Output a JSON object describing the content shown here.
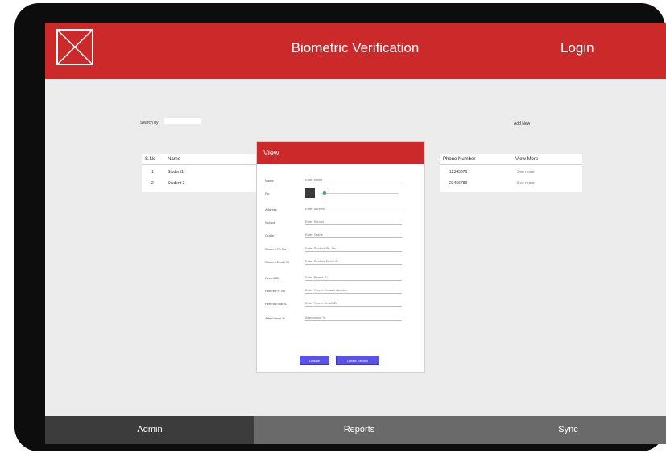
{
  "header": {
    "title": "Biometric Verification",
    "login_label": "Login"
  },
  "toolbar": {
    "search_label": "Search by",
    "add_new_label": "Add New"
  },
  "table": {
    "headers": [
      "S.No",
      "Name",
      "Phone Number",
      "View More"
    ],
    "rows": [
      {
        "sno": "1",
        "name": "Student1",
        "phone": "12345678",
        "view": "See more"
      },
      {
        "sno": "2",
        "name": "Student 2",
        "phone": "23456789",
        "view": "See more"
      }
    ]
  },
  "modal": {
    "title": "View",
    "fields": [
      {
        "label": "Name",
        "placeholder": "Enter Name"
      },
      {
        "label": "Pic",
        "placeholder": ""
      },
      {
        "label": "Address",
        "placeholder": "Enter Address"
      },
      {
        "label": "School",
        "placeholder": "Enter School"
      },
      {
        "label": "Grade",
        "placeholder": "Enter Grade"
      },
      {
        "label": "Student Ph No",
        "placeholder": "Enter Student Ph. No"
      },
      {
        "label": "Student Email ID",
        "placeholder": "Enter Student Email ID"
      },
      {
        "label": "Parent ID",
        "placeholder": "Enter Parent ID"
      },
      {
        "label": "Parent Ph. No",
        "placeholder": "Enter Parent Contact Number"
      },
      {
        "label": "Parent Email ID",
        "placeholder": "Enter Parent Email ID"
      },
      {
        "label": "Attendance %",
        "placeholder": "Attendance %"
      }
    ],
    "update_label": "Update",
    "delete_label": "Delete Record"
  },
  "nav": {
    "tabs": [
      {
        "label": "Admin"
      },
      {
        "label": "Reports"
      },
      {
        "label": "Sync"
      }
    ]
  },
  "colors": {
    "header": "#cc2a2a",
    "accent_button": "#5a54e6",
    "active_tab": "#3c3c3c",
    "inactive_tab": "#6a6a6a"
  },
  "icons": {
    "logo": "image-placeholder-icon"
  }
}
